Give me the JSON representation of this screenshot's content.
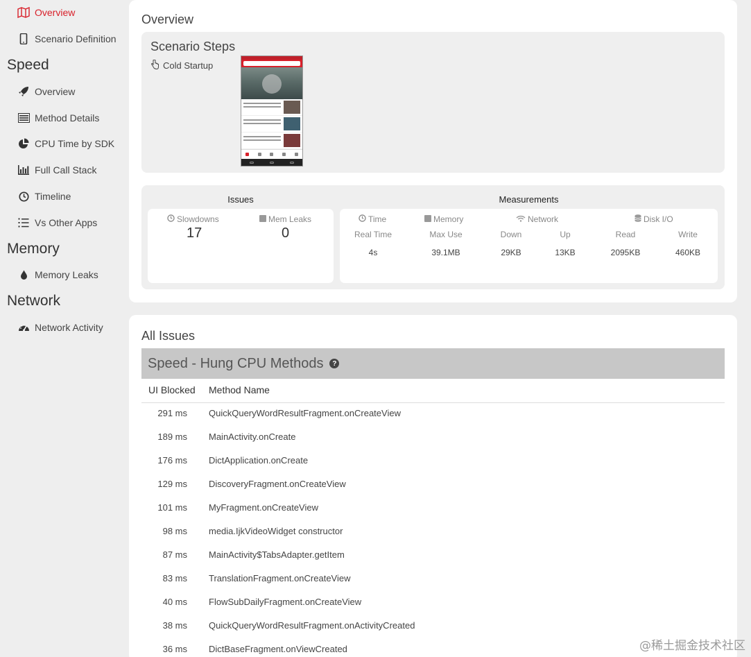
{
  "sidebar": {
    "top_items": [
      {
        "label": "Overview",
        "icon": "map-icon",
        "active": true
      },
      {
        "label": "Scenario Definition",
        "icon": "mobile-icon"
      }
    ],
    "sections": [
      {
        "title": "Speed",
        "items": [
          {
            "label": "Overview",
            "icon": "rocket-icon"
          },
          {
            "label": "Method Details",
            "icon": "list-alt-icon"
          },
          {
            "label": "CPU Time by SDK",
            "icon": "pie-chart-icon"
          },
          {
            "label": "Full Call Stack",
            "icon": "bar-chart-icon"
          },
          {
            "label": "Timeline",
            "icon": "clock-icon"
          },
          {
            "label": "Vs Other Apps",
            "icon": "list-ol-icon"
          }
        ]
      },
      {
        "title": "Memory",
        "items": [
          {
            "label": "Memory Leaks",
            "icon": "drop-icon"
          }
        ]
      },
      {
        "title": "Network",
        "items": [
          {
            "label": "Network Activity",
            "icon": "dashboard-icon"
          }
        ]
      }
    ]
  },
  "overview": {
    "title": "Overview",
    "scenario": {
      "title": "Scenario Steps",
      "step_label": "Cold Startup",
      "step_icon": "pointer-hand-icon"
    },
    "issues": {
      "title": "Issues",
      "slowdowns_label": "Slowdowns",
      "slowdowns_value": "17",
      "memleaks_label": "Mem Leaks",
      "memleaks_value": "0"
    },
    "measurements": {
      "title": "Measurements",
      "time_label": "Time",
      "memory_label": "Memory",
      "network_label": "Network",
      "disk_label": "Disk I/O",
      "real_time_label": "Real Time",
      "max_use_label": "Max Use",
      "down_label": "Down",
      "up_label": "Up",
      "read_label": "Read",
      "write_label": "Write",
      "real_time": "4s",
      "max_use": "39.1MB",
      "down": "29KB",
      "up": "13KB",
      "read": "2095KB",
      "write": "460KB"
    }
  },
  "all_issues": {
    "title": "All Issues",
    "section_title": "Speed - Hung CPU Methods",
    "help_glyph": "?",
    "columns": {
      "blocked": "UI Blocked",
      "method": "Method Name"
    },
    "rows": [
      {
        "ms": "291 ms",
        "method": "QuickQueryWordResultFragment.onCreateView"
      },
      {
        "ms": "189 ms",
        "method": "MainActivity.onCreate"
      },
      {
        "ms": "176 ms",
        "method": "DictApplication.onCreate"
      },
      {
        "ms": "129 ms",
        "method": "DiscoveryFragment.onCreateView"
      },
      {
        "ms": "101 ms",
        "method": "MyFragment.onCreateView"
      },
      {
        "ms": "98 ms",
        "method": "media.IjkVideoWidget constructor"
      },
      {
        "ms": "87 ms",
        "method": "MainActivity$TabsAdapter.getItem"
      },
      {
        "ms": "83 ms",
        "method": "TranslationFragment.onCreateView"
      },
      {
        "ms": "40 ms",
        "method": "FlowSubDailyFragment.onCreateView"
      },
      {
        "ms": "38 ms",
        "method": "QuickQueryWordResultFragment.onActivityCreated"
      },
      {
        "ms": "36 ms",
        "method": "DictBaseFragment.onViewCreated"
      }
    ]
  },
  "watermark": "@稀土掘金技术社区",
  "colors": {
    "accent": "#d8202a",
    "panel": "#ffffff",
    "background": "#eeeeee",
    "section_header": "#c7c7c7"
  }
}
